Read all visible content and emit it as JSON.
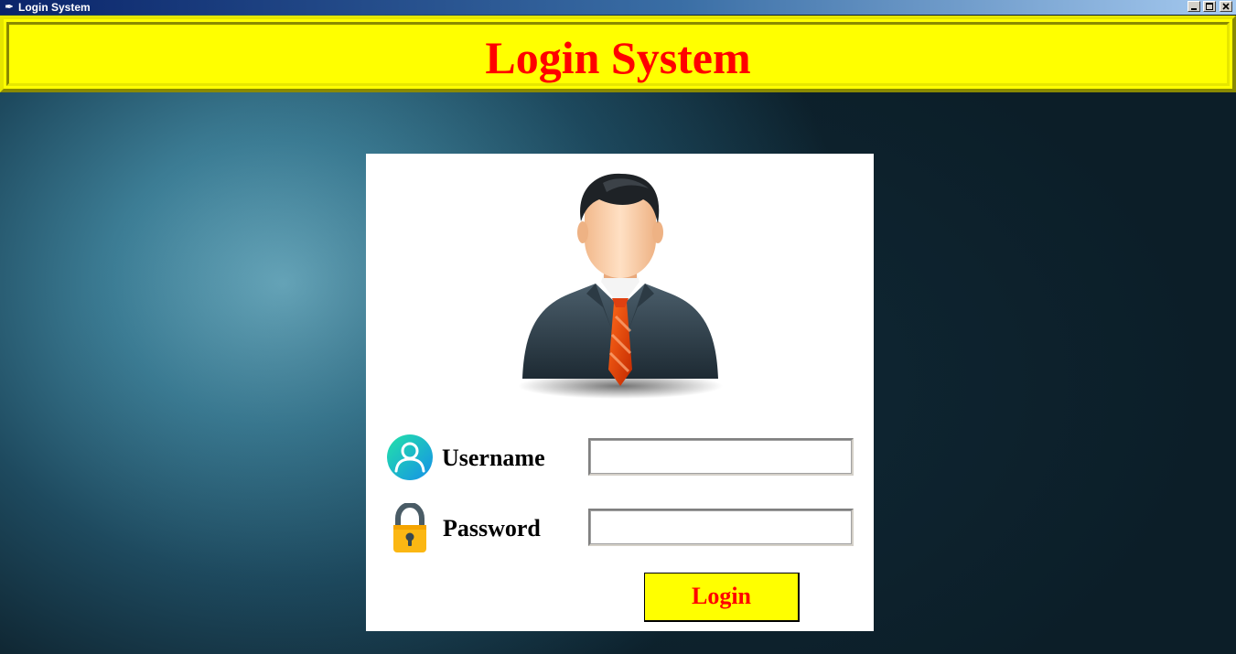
{
  "window": {
    "title": "Login System",
    "controls": [
      "minimize",
      "maximize",
      "close"
    ]
  },
  "banner": {
    "title": "Login System"
  },
  "form": {
    "username_label": "Username",
    "username_value": "",
    "password_label": "Password",
    "password_value": "",
    "login_label": "Login"
  },
  "icons": {
    "avatar": "businessman-avatar-icon",
    "username": "user-icon",
    "password": "lock-icon"
  },
  "colors": {
    "banner_bg": "#ffff00",
    "banner_text": "#ff0000",
    "button_bg": "#ffff00",
    "button_text": "#ff0000",
    "background": "#1e4a5f"
  }
}
